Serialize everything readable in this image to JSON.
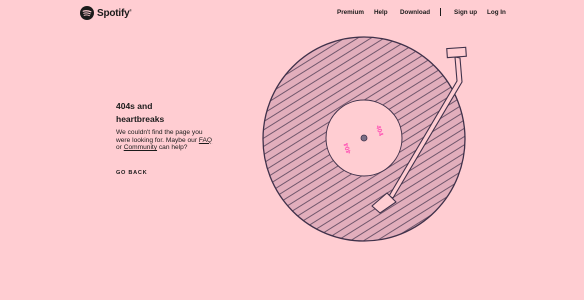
{
  "header": {
    "logo_text": "Spotify",
    "logo_tm": "®",
    "nav": {
      "premium": "Premium",
      "help": "Help",
      "download": "Download",
      "signup": "Sign up",
      "login": "Log In"
    }
  },
  "main": {
    "heading_line1": "404s and",
    "heading_line2": "heartbreaks",
    "message_before_faq": "We couldn't find the page you were looking for. Maybe our ",
    "faq_link": "FAQ",
    "message_or": " or ",
    "community_link": "Community",
    "message_after": " can help?",
    "go_back": "GO BACK",
    "label_text": "404"
  },
  "colors": {
    "background": "#ffcdd2",
    "record": "#e2aebc",
    "label": "#ffcdd2",
    "label_text": "#ff4fb3",
    "outline": "#40314a"
  }
}
